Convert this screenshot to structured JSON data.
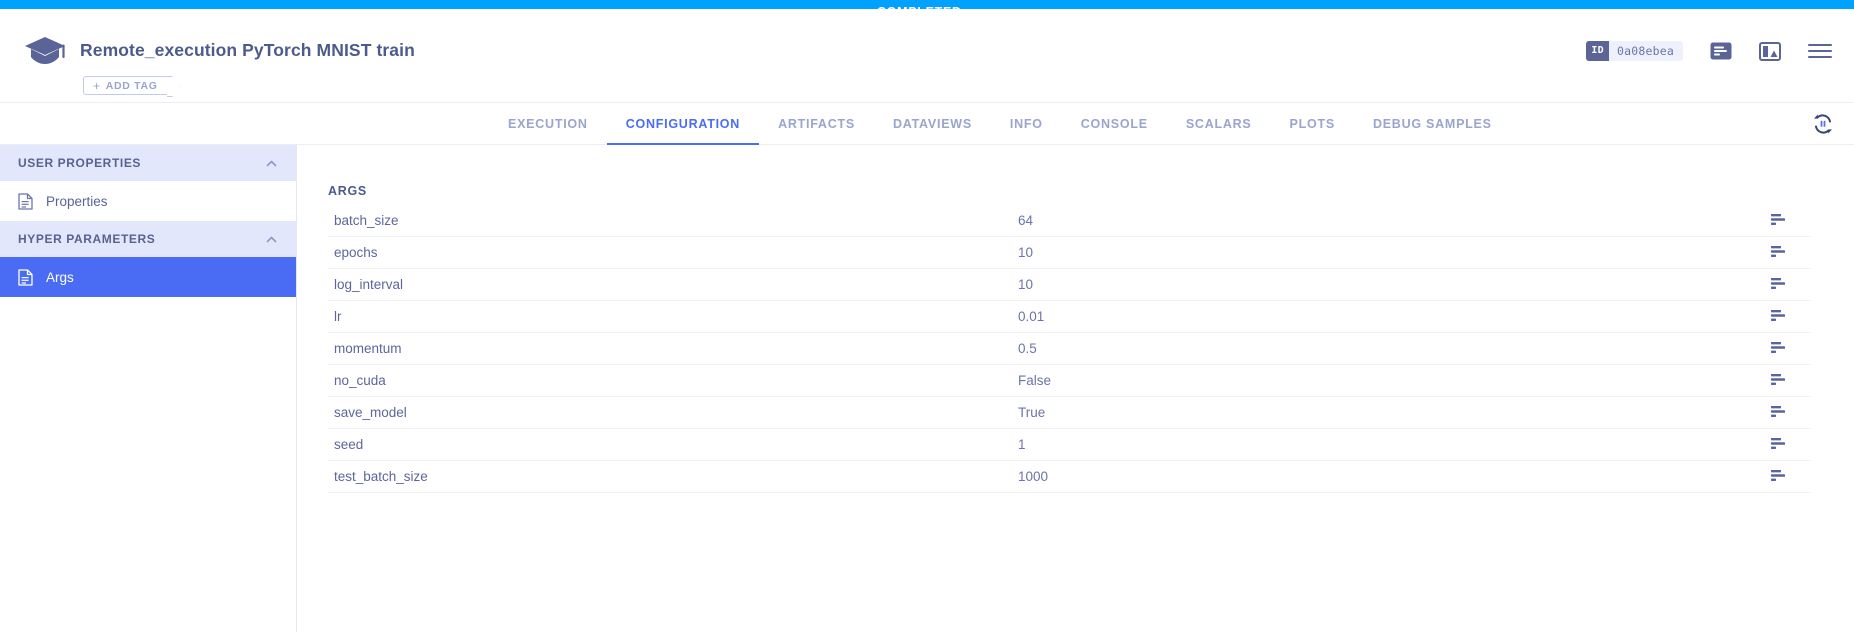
{
  "status": {
    "label": "COMPLETED",
    "color": "#00a1ff"
  },
  "header": {
    "title": "Remote_execution PyTorch MNIST train",
    "add_tag_label": "ADD TAG",
    "add_tag_plus": "+",
    "id_key": "ID",
    "id_value": "0a08ebea",
    "icons": [
      "log-icon",
      "panel-icon",
      "hamburger-menu-icon"
    ]
  },
  "tabs": [
    {
      "label": "EXECUTION",
      "active": false
    },
    {
      "label": "CONFIGURATION",
      "active": true
    },
    {
      "label": "ARTIFACTS",
      "active": false
    },
    {
      "label": "DATAVIEWS",
      "active": false
    },
    {
      "label": "INFO",
      "active": false
    },
    {
      "label": "CONSOLE",
      "active": false
    },
    {
      "label": "SCALARS",
      "active": false
    },
    {
      "label": "PLOTS",
      "active": false
    },
    {
      "label": "DEBUG SAMPLES",
      "active": false
    }
  ],
  "tab_accent": "#4a6cf5",
  "sidebar": {
    "sections": [
      {
        "label": "USER PROPERTIES",
        "items": [
          {
            "label": "Properties",
            "active": false
          }
        ]
      },
      {
        "label": "HYPER PARAMETERS",
        "items": [
          {
            "label": "Args",
            "active": true
          }
        ]
      }
    ]
  },
  "main": {
    "section_title": "ARGS",
    "rows": [
      {
        "name": "batch_size",
        "value": "64"
      },
      {
        "name": "epochs",
        "value": "10"
      },
      {
        "name": "log_interval",
        "value": "10"
      },
      {
        "name": "lr",
        "value": "0.01"
      },
      {
        "name": "momentum",
        "value": "0.5"
      },
      {
        "name": "no_cuda",
        "value": "False"
      },
      {
        "name": "save_model",
        "value": "True"
      },
      {
        "name": "seed",
        "value": "1"
      },
      {
        "name": "test_batch_size",
        "value": "1000"
      }
    ]
  }
}
